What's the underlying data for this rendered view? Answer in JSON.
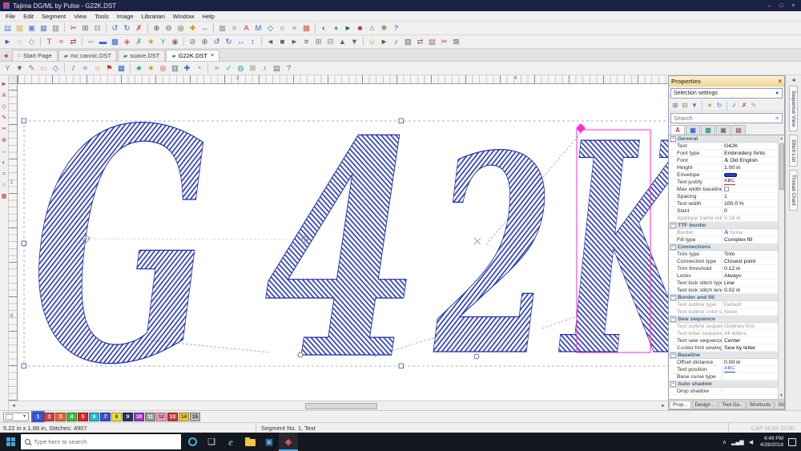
{
  "window": {
    "title": "Tajima DG/ML by Pulse - G22K.DST",
    "controls": {
      "minimize": "–",
      "maximize": "□",
      "close": "×"
    }
  },
  "menu": {
    "items": [
      "File",
      "Edit",
      "Segment",
      "View",
      "Tools",
      "Image",
      "Librarian",
      "Window",
      "Help"
    ]
  },
  "toolbar1": [
    {
      "n": "new-file-icon",
      "g": "▤",
      "c": "#5b87d6"
    },
    {
      "n": "open-file-icon",
      "g": "▨",
      "c": "#d9a53c"
    },
    {
      "n": "save-file-icon",
      "g": "▣",
      "c": "#5b87d6"
    },
    {
      "n": "save-all-icon",
      "g": "▦",
      "c": "#5b87d6"
    },
    {
      "n": "print-icon",
      "g": "▥",
      "c": "#778"
    },
    {
      "sep": 1
    },
    {
      "n": "cut-icon",
      "g": "✂",
      "c": "#b23333"
    },
    {
      "n": "copy-icon",
      "g": "⊞",
      "c": "#556677"
    },
    {
      "n": "paste-icon",
      "g": "⊟",
      "c": "#778866"
    },
    {
      "sep": 1
    },
    {
      "n": "undo-icon",
      "g": "↺",
      "c": "#3366cc"
    },
    {
      "n": "redo-icon",
      "g": "↻",
      "c": "#3366cc"
    },
    {
      "n": "delete-icon",
      "g": "✗",
      "c": "#cc3333"
    },
    {
      "sep": 1
    },
    {
      "n": "zoom-in-icon",
      "g": "⊕",
      "c": "#336633"
    },
    {
      "n": "zoom-out-icon",
      "g": "⊖",
      "c": "#336633"
    },
    {
      "n": "zoom-fit-icon",
      "g": "◎",
      "c": "#336633"
    },
    {
      "n": "pan-icon",
      "g": "✚",
      "c": "#cc9900"
    },
    {
      "n": "measure-icon",
      "g": "↔",
      "c": "#8866cc"
    },
    {
      "sep": 1
    },
    {
      "n": "grid-icon",
      "g": "▦",
      "c": "#999999"
    },
    {
      "n": "ruler-icon",
      "g": "≡",
      "c": "#999999"
    },
    {
      "n": "text-tool-icon",
      "g": "A",
      "c": "#cc3333"
    },
    {
      "n": "monogram-icon",
      "g": "M",
      "c": "#3366cc"
    },
    {
      "n": "node-edit-icon",
      "g": "◇",
      "c": "#3366cc"
    },
    {
      "n": "shape-tool-icon",
      "g": "○",
      "c": "#336633"
    },
    {
      "n": "curve-tool-icon",
      "g": "≈",
      "c": "#6666cc"
    },
    {
      "n": "fill-tool-icon",
      "g": "▩",
      "c": "#cc6633"
    },
    {
      "sep": 1
    },
    {
      "n": "color-palette-icon",
      "g": "◐",
      "c": "#cc3399"
    },
    {
      "n": "thread-colors-icon",
      "g": "♦",
      "c": "#33aaaa"
    },
    {
      "n": "simulate-icon",
      "g": "►",
      "c": "#336633"
    },
    {
      "n": "stop-icon",
      "g": "■",
      "c": "#cc3333"
    },
    {
      "n": "machine-connect-icon",
      "g": "⌂",
      "c": "#556677"
    },
    {
      "n": "settings-icon",
      "g": "✱",
      "c": "#998877"
    },
    {
      "n": "help-icon",
      "g": "?",
      "c": "#3366cc"
    }
  ],
  "toolbar2": [
    {
      "n": "select-arrow-icon",
      "g": "►",
      "c": "#3366cc"
    },
    {
      "n": "lasso-select-icon",
      "g": "◌",
      "c": "#3366cc"
    },
    {
      "n": "edit-points-icon",
      "g": "◇",
      "c": "#cc6633"
    },
    {
      "sep": 1
    },
    {
      "n": "text-vertical-icon",
      "g": "T",
      "c": "#cc3333"
    },
    {
      "n": "text-path-icon",
      "g": "≈",
      "c": "#cc3333"
    },
    {
      "n": "letter-spacing-icon",
      "g": "⇄",
      "c": "#cc3333"
    },
    {
      "sep": 1
    },
    {
      "n": "run-stitch-icon",
      "g": "─",
      "c": "#3366cc"
    },
    {
      "n": "satin-stitch-icon",
      "g": "▬",
      "c": "#3366cc"
    },
    {
      "n": "complex-fill-icon",
      "g": "▩",
      "c": "#3366cc"
    },
    {
      "n": "applique-icon",
      "g": "◈",
      "c": "#cc6633"
    },
    {
      "n": "cross-stitch-icon",
      "g": "✗",
      "c": "#33aa66"
    },
    {
      "n": "motif-stitch-icon",
      "g": "★",
      "c": "#cc9933"
    },
    {
      "n": "branch-icon",
      "g": "Y",
      "c": "#33aa66"
    },
    {
      "n": "auto-digitize-icon",
      "g": "◉",
      "c": "#996666"
    },
    {
      "sep": 1
    },
    {
      "n": "remove-overlap-icon",
      "g": "⊘",
      "c": "#666666"
    },
    {
      "n": "weld-icon",
      "g": "⊕",
      "c": "#666666"
    },
    {
      "n": "rotate-left-icon",
      "g": "↺",
      "c": "#3366cc"
    },
    {
      "n": "rotate-right-icon",
      "g": "↻",
      "c": "#3366cc"
    },
    {
      "n": "mirror-h-icon",
      "g": "↔",
      "c": "#3366cc"
    },
    {
      "n": "mirror-v-icon",
      "g": "↕",
      "c": "#3366cc"
    },
    {
      "sep": 1
    },
    {
      "n": "align-left-icon",
      "g": "◄",
      "c": "#556677"
    },
    {
      "n": "align-center-icon",
      "g": "■",
      "c": "#556677"
    },
    {
      "n": "align-right-icon",
      "g": "►",
      "c": "#556677"
    },
    {
      "n": "distribute-icon",
      "g": "≡",
      "c": "#556677"
    },
    {
      "n": "group-icon",
      "g": "⊞",
      "c": "#778866"
    },
    {
      "n": "ungroup-icon",
      "g": "⊟",
      "c": "#778866"
    },
    {
      "n": "bring-front-icon",
      "g": "▲",
      "c": "#666666"
    },
    {
      "n": "send-back-icon",
      "g": "▼",
      "c": "#666666"
    },
    {
      "sep": 1
    },
    {
      "n": "smiley-icon",
      "g": "☺",
      "c": "#ccaa00"
    },
    {
      "n": "slow-redraw-icon",
      "g": "►",
      "c": "#336633"
    },
    {
      "n": "stitch-player-icon",
      "g": "♪",
      "c": "#3366cc"
    },
    {
      "n": "density-icon",
      "g": "▨",
      "c": "#666666"
    },
    {
      "n": "pull-comp-icon",
      "g": "⇄",
      "c": "#996666"
    },
    {
      "n": "underlay-icon",
      "g": "▤",
      "c": "#996666"
    },
    {
      "n": "trim-tool-icon",
      "g": "✂",
      "c": "#b23333"
    },
    {
      "n": "lock-stitch-icon",
      "g": "⊠",
      "c": "#666666"
    }
  ],
  "toolbar3": [
    {
      "n": "branch-tool-icon",
      "g": "Y",
      "c": "#33aa55"
    },
    {
      "n": "filter-icon",
      "g": "▼",
      "c": "#666666"
    },
    {
      "n": "pencil-icon",
      "g": "✎",
      "c": "#cc6633"
    },
    {
      "n": "eraser-icon",
      "g": "▭",
      "c": "#cc9999"
    },
    {
      "n": "reshape-icon",
      "g": "◇",
      "c": "#3366cc"
    },
    {
      "sep": 1
    },
    {
      "n": "knife-icon",
      "g": "/",
      "c": "#666666"
    },
    {
      "n": "swirl-icon",
      "g": "≈",
      "c": "#3366cc"
    },
    {
      "n": "sun-icon",
      "g": "☼",
      "c": "#dd9900"
    },
    {
      "n": "flag-icon",
      "g": "⚑",
      "c": "#cc3333"
    },
    {
      "n": "blue-grid-icon",
      "g": "▦",
      "c": "#3366cc"
    },
    {
      "sep": 1
    },
    {
      "n": "clover-icon",
      "g": "♣",
      "c": "#33aa55"
    },
    {
      "n": "star-icon",
      "g": "★",
      "c": "#cc9933"
    },
    {
      "n": "target-icon",
      "g": "◎",
      "c": "#cc3333"
    },
    {
      "n": "chart-icon",
      "g": "▥",
      "c": "#556677"
    },
    {
      "n": "pin-icon",
      "g": "✚",
      "c": "#3366cc"
    },
    {
      "n": "magnet-icon",
      "g": "◔",
      "c": "#996666"
    },
    {
      "sep": 1
    },
    {
      "n": "wave-icon",
      "g": "≈",
      "c": "#6666cc"
    },
    {
      "n": "check-icon",
      "g": "✓",
      "c": "#33aa55"
    },
    {
      "n": "globe-icon",
      "g": "◍",
      "c": "#33aaaa"
    },
    {
      "n": "lock-icon",
      "g": "⊠",
      "c": "#999988"
    },
    {
      "n": "note-icon",
      "g": "♪",
      "c": "#6666cc"
    },
    {
      "n": "layers-icon",
      "g": "▤",
      "c": "#666666"
    },
    {
      "n": "question-icon",
      "g": "?",
      "c": "#3366cc"
    }
  ],
  "left_toolbar": [
    {
      "n": "pointer-tool-icon",
      "g": "►",
      "c": "#c0392b"
    },
    {
      "n": "text-insert-icon",
      "g": "A",
      "c": "#c0392b"
    },
    {
      "n": "shape-insert-icon",
      "g": "◇",
      "c": "#c0392b"
    },
    {
      "n": "artwork-pencil-icon",
      "g": "✎",
      "c": "#c0392b"
    },
    {
      "n": "scissors-tool-icon",
      "g": "✂",
      "c": "#c0392b"
    },
    {
      "n": "zoom-tool-icon",
      "g": "⊕",
      "c": "#c0392b"
    },
    {
      "n": "measure-tool-icon",
      "g": "↔",
      "c": "#c0392b"
    },
    {
      "n": "color-tool-icon",
      "g": "◐",
      "c": "#c0392b"
    },
    {
      "n": "stitch-edit-icon",
      "g": "≈",
      "c": "#c0392b"
    },
    {
      "n": "node-tool-icon",
      "g": "○",
      "c": "#c0392b"
    },
    {
      "n": "grid-tool-icon",
      "g": "▦",
      "c": "#c0392b"
    }
  ],
  "tabs": [
    {
      "label": "Start Page",
      "icon": "⌂",
      "icon_color": "#c87137"
    },
    {
      "label": "mc cannic.DST",
      "icon": "▰",
      "icon_color": "#3a9a5a"
    },
    {
      "label": "suave.DST",
      "icon": "▰",
      "icon_color": "#3a9a5a"
    },
    {
      "label": "G22K.DST",
      "icon": "▰",
      "icon_color": "#3a9a5a",
      "active": true,
      "close": true
    }
  ],
  "canvas": {
    "letters": [
      "G",
      "4",
      "2",
      "K"
    ],
    "ruler_top": [
      "2",
      "4"
    ],
    "ruler_left": [
      "1",
      "0"
    ]
  },
  "properties": {
    "title": "Properties",
    "selector": "Selection settings",
    "search_placeholder": "Search",
    "header_icons": [
      {
        "n": "copy-settings-icon",
        "g": "⊞",
        "c": "#4a6a8a"
      },
      {
        "n": "paste-settings-icon",
        "g": "⊟",
        "c": "#8a6a4a"
      },
      {
        "n": "load-recipe-icon",
        "g": "▼",
        "c": "#3a7ad4"
      },
      {
        "sep": 1
      },
      {
        "n": "favorites-icon",
        "g": "★",
        "c": "#d4a03a"
      },
      {
        "n": "history-icon",
        "g": "↻",
        "c": "#3a7ad4"
      },
      {
        "sep": 1
      },
      {
        "n": "apply-settings-icon",
        "g": "✓",
        "c": "#3a9a4a"
      },
      {
        "n": "reset-settings-icon",
        "g": "✗",
        "c": "#c03a3a"
      },
      {
        "n": "edit-recipe-icon",
        "g": "✎",
        "c": "#c8a040"
      }
    ],
    "category_tabs": [
      {
        "n": "text-category-tab",
        "g": "A",
        "c": "#c0392b",
        "active": true
      },
      {
        "n": "outline-category-tab",
        "g": "▦",
        "c": "#3a6ad4"
      },
      {
        "n": "fill-category-tab",
        "g": "▩",
        "c": "#3a9a9a"
      },
      {
        "n": "machine-category-tab",
        "g": "▣",
        "c": "#777777"
      },
      {
        "n": "summary-category-tab",
        "g": "▤",
        "c": "#996677"
      }
    ],
    "grid": [
      {
        "t": "sec",
        "label": "General"
      },
      {
        "t": "row",
        "label": "Text",
        "value": "G42K"
      },
      {
        "t": "row",
        "label": "Font type",
        "value": "Embroidery fonts"
      },
      {
        "t": "row",
        "label": "Font",
        "value": "Old English",
        "icon": {
          "g": "A",
          "c": "#333366"
        }
      },
      {
        "t": "row",
        "label": "Height",
        "value": "1.00 in"
      },
      {
        "t": "row",
        "label": "Envelope",
        "kind": "swatch"
      },
      {
        "t": "row",
        "label": "Text justify",
        "value": "ABC",
        "kind": "abc"
      },
      {
        "t": "row",
        "label": "Max width baseline",
        "kind": "check"
      },
      {
        "t": "row",
        "label": "Spacing",
        "value": "1"
      },
      {
        "t": "row",
        "label": "Text width",
        "value": "100.0 %"
      },
      {
        "t": "row",
        "label": "Slant",
        "value": "0"
      },
      {
        "t": "row",
        "label": "Applique frame out...",
        "value": "0.16 in",
        "dim": true
      },
      {
        "t": "sec",
        "label": "TTF border"
      },
      {
        "t": "row",
        "label": "Border",
        "value": "None",
        "icon": {
          "g": "A",
          "c": "#8a2be2"
        },
        "dim": true
      },
      {
        "t": "row",
        "label": "Fill type",
        "value": "Complex fill"
      },
      {
        "t": "sec",
        "label": "Connections"
      },
      {
        "t": "row",
        "label": "Trim type",
        "value": "Trim"
      },
      {
        "t": "row",
        "label": "Connection type",
        "value": "Closest point"
      },
      {
        "t": "row",
        "label": "Trim threshold",
        "value": "0.12 in"
      },
      {
        "t": "row",
        "label": "Locks",
        "value": "Always"
      },
      {
        "t": "row",
        "label": "Text lock stitch type",
        "value": "Line"
      },
      {
        "t": "row",
        "label": "Text lock stitch leng...",
        "value": "0.02 in"
      },
      {
        "t": "sec",
        "label": "Border and fill"
      },
      {
        "t": "row",
        "label": "Text outline type",
        "value": "Default",
        "dim": true
      },
      {
        "t": "row",
        "label": "Text outline color c...",
        "value": "None",
        "dim": true
      },
      {
        "t": "sec",
        "label": "Sew sequence"
      },
      {
        "t": "row",
        "label": "Text outline sequen...",
        "value": "Outlines first",
        "dim": true
      },
      {
        "t": "row",
        "label": "Text letter sequence",
        "value": "All letters",
        "dim": true
      },
      {
        "t": "row",
        "label": "Text sew sequence",
        "value": "Center"
      },
      {
        "t": "row",
        "label": "2-color font sewing...",
        "value": "Sew by letter"
      },
      {
        "t": "sec",
        "label": "Baseline"
      },
      {
        "t": "row",
        "label": "Offset distance",
        "value": "0.00 in"
      },
      {
        "t": "row",
        "label": "Text position",
        "value": "ABC",
        "kind": "abc2"
      },
      {
        "t": "row",
        "label": "Base curve type",
        "value": ""
      },
      {
        "t": "sec",
        "label": "Auto shadow"
      },
      {
        "t": "row",
        "label": "Drop shadow",
        "value": ""
      }
    ],
    "bottom_tabs": [
      "Prop...",
      "Design ..",
      "Tool Gu..",
      "Shortcuts",
      "Global .."
    ]
  },
  "right_strip": {
    "tabs": [
      {
        "label": "Sequence View"
      },
      {
        "label": "Stitch List"
      },
      {
        "label": "Thread Chart"
      }
    ]
  },
  "palette": {
    "colors": [
      {
        "n": 1,
        "c": "#3c5ae0",
        "tc": "#ffffff",
        "selected": true
      },
      {
        "n": 2,
        "c": "#e03c3c",
        "tc": "#ffffff"
      },
      {
        "n": 3,
        "c": "#e06a3c",
        "tc": "#ffffff"
      },
      {
        "n": 4,
        "c": "#44b944",
        "tc": "#ffffff"
      },
      {
        "n": 5,
        "c": "#d42b2b",
        "tc": "#ffffff"
      },
      {
        "n": 6,
        "c": "#2bb9c9",
        "tc": "#ffffff"
      },
      {
        "n": 7,
        "c": "#3c50d4",
        "tc": "#ffffff"
      },
      {
        "n": 8,
        "c": "#e8e23c",
        "tc": "#333333"
      },
      {
        "n": 9,
        "c": "#26355e",
        "tc": "#ffffff"
      },
      {
        "n": 10,
        "c": "#9a3cc9",
        "tc": "#ffffff"
      },
      {
        "n": 11,
        "c": "#9a9a9a",
        "tc": "#ffffff"
      },
      {
        "n": 12,
        "c": "#f0a0c0",
        "tc": "#333333"
      },
      {
        "n": 13,
        "c": "#c93c3c",
        "tc": "#ffffff"
      },
      {
        "n": 14,
        "c": "#e8c93c",
        "tc": "#333333"
      },
      {
        "n": 15,
        "c": "#b9b9b9",
        "tc": "#333333"
      }
    ]
  },
  "status": {
    "left": "5.22 in x 1.88 in, Stitches: 4907",
    "segment": "Segment No. 1, Text",
    "indicators": "CAP NUM SCRL"
  },
  "taskbar": {
    "search_placeholder": "Type here to search",
    "icons": [
      {
        "n": "cortana-icon",
        "k": "cortana"
      },
      {
        "n": "task-view-icon",
        "g": "❏",
        "c": "#dfe5ec"
      },
      {
        "n": "edge-icon",
        "k": "edge",
        "g": "e"
      },
      {
        "n": "file-explorer-icon",
        "k": "folder"
      },
      {
        "n": "store-icon",
        "g": "▣",
        "c": "#57a8e8"
      },
      {
        "n": "tajima-app-icon",
        "g": "◆",
        "c": "#e85050",
        "active": true
      }
    ],
    "tray": [
      {
        "n": "tray-expand-icon",
        "g": "∧"
      },
      {
        "n": "network-icon",
        "g": "▂▄▆"
      },
      {
        "n": "volume-icon",
        "g": "◀"
      }
    ],
    "time": "4:49 PM",
    "date": "4/28/2018"
  }
}
